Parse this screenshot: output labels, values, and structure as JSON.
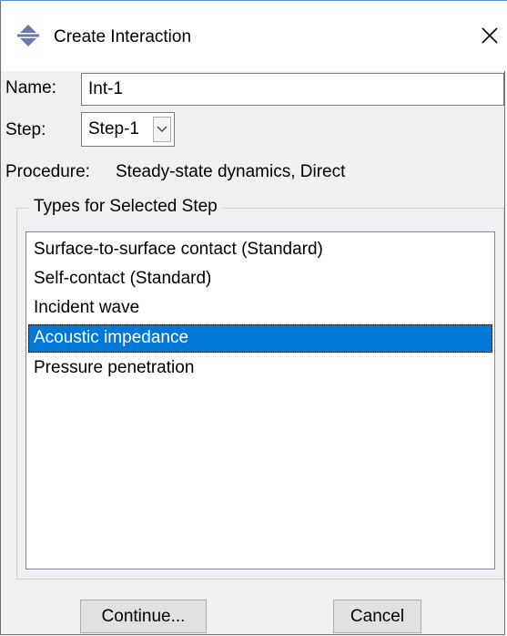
{
  "dialog": {
    "title": "Create Interaction",
    "close_icon": "close-icon",
    "app_icon": "interaction-icon"
  },
  "form": {
    "name_label": "Name:",
    "name_value": "Int-1",
    "step_label": "Step:",
    "step_value": "Step-1",
    "procedure_label": "Procedure:",
    "procedure_value": "Steady-state dynamics, Direct"
  },
  "types": {
    "group_title": "Types for Selected Step",
    "items": [
      "Surface-to-surface contact (Standard)",
      "Self-contact (Standard)",
      "Incident wave",
      "Acoustic impedance",
      "Pressure penetration"
    ],
    "selected": "Acoustic impedance"
  },
  "buttons": {
    "continue_label": "Continue...",
    "cancel_label": "Cancel"
  },
  "colors": {
    "selection": "#0078d7",
    "dialog_bg": "#f0f0f0",
    "accent_border": "#5c8fd6"
  }
}
